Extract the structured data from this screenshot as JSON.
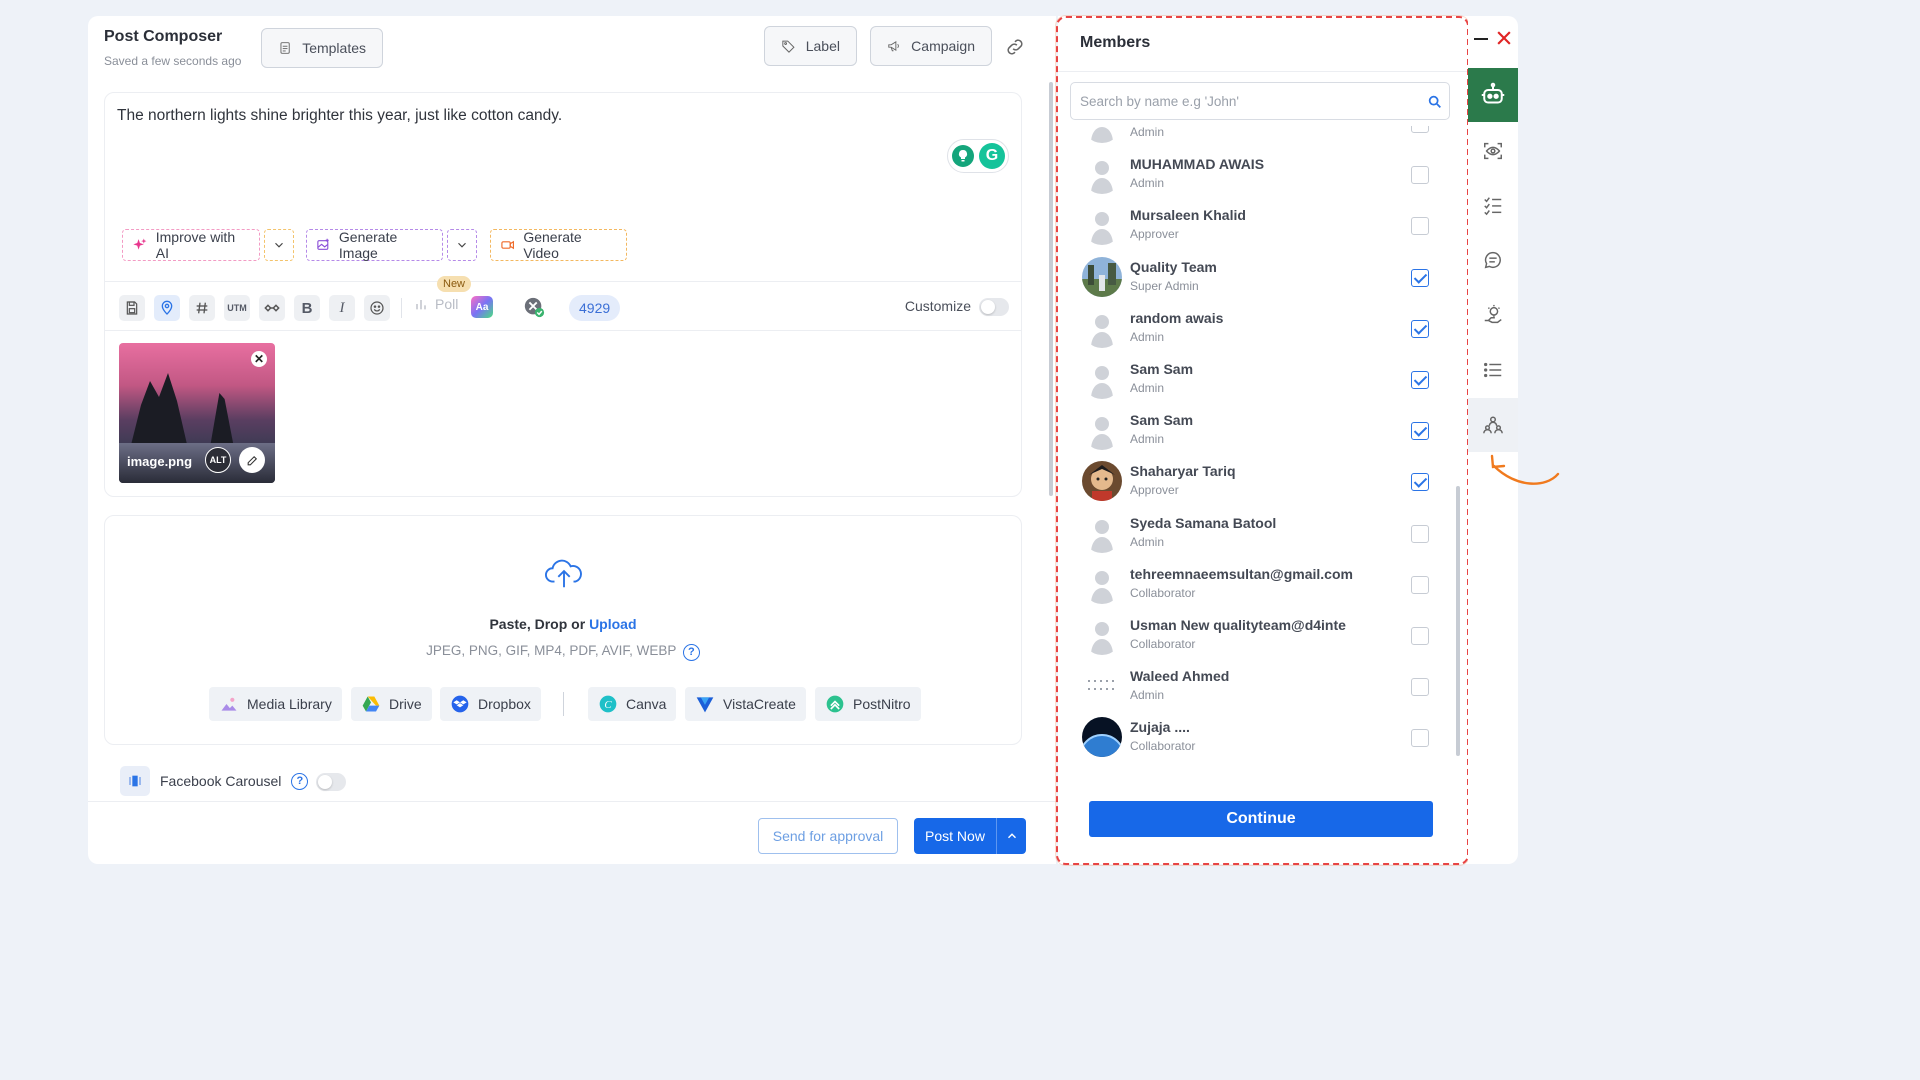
{
  "header": {
    "title": "Post Composer",
    "subtitle": "Saved a few seconds ago",
    "templates_label": "Templates",
    "label_label": "Label",
    "campaign_label": "Campaign"
  },
  "editor": {
    "text": "The northern lights shine brighter this year, just like cotton candy.",
    "improve_label": "Improve with AI",
    "generate_image_label": "Generate Image",
    "generate_video_label": "Generate Video",
    "poll_label": "Poll",
    "new_badge": "New",
    "utm_label": "UTM",
    "bold_label": "B",
    "italic_label": "I",
    "aa_label": "Aa",
    "char_count": "4929",
    "customize_label": "Customize",
    "customize_on": false
  },
  "media": {
    "filename": "image.png",
    "alt_label": "ALT"
  },
  "upload": {
    "prompt_prefix": "Paste, Drop or",
    "upload_link": "Upload",
    "formats": "JPEG, PNG, GIF, MP4, PDF, AVIF, WEBP",
    "sources": [
      "Media Library",
      "Drive",
      "Dropbox",
      "Canva",
      "VistaCreate",
      "PostNitro"
    ]
  },
  "carousel": {
    "label": "Facebook Carousel",
    "enabled": false
  },
  "footer": {
    "approval_label": "Send for approval",
    "post_now_label": "Post Now"
  },
  "members": {
    "title": "Members",
    "search_placeholder": "Search by name e.g 'John'",
    "continue_label": "Continue",
    "items": [
      {
        "name": "",
        "role": "Admin",
        "checked": false,
        "avatar": "default"
      },
      {
        "name": "MUHAMMAD AWAIS",
        "role": "Admin",
        "checked": false,
        "avatar": "default"
      },
      {
        "name": "Mursaleen Khalid",
        "role": "Approver",
        "checked": false,
        "avatar": "default"
      },
      {
        "name": "Quality Team",
        "role": "Super Admin",
        "checked": true,
        "avatar": "photo-outdoor"
      },
      {
        "name": "random awais",
        "role": "Admin",
        "checked": true,
        "avatar": "default"
      },
      {
        "name": "Sam Sam",
        "role": "Admin",
        "checked": true,
        "avatar": "default"
      },
      {
        "name": "Sam Sam",
        "role": "Admin",
        "checked": true,
        "avatar": "default"
      },
      {
        "name": "Shaharyar Tariq",
        "role": "Approver",
        "checked": true,
        "avatar": "photo-portrait"
      },
      {
        "name": "Syeda Samana Batool",
        "role": "Admin",
        "checked": false,
        "avatar": "default"
      },
      {
        "name": "tehreemnaeemsultan@gmail.com",
        "role": "Collaborator",
        "checked": false,
        "avatar": "default"
      },
      {
        "name": "Usman New qualityteam@d4inte",
        "role": "Collaborator",
        "checked": false,
        "avatar": "default"
      },
      {
        "name": "Waleed Ahmed",
        "role": "Admin",
        "checked": false,
        "avatar": "pattern"
      },
      {
        "name": "Zujaja ....",
        "role": "Collaborator",
        "checked": false,
        "avatar": "photo-earth"
      }
    ]
  },
  "rail": {
    "icons": [
      "robot-icon",
      "eye-scan-icon",
      "checklist-icon",
      "comment-icon",
      "idea-hand-icon",
      "list-icon",
      "members-icon"
    ],
    "active": "members-icon"
  },
  "colors": {
    "primary": "#1768e8",
    "annotation": "#e84444",
    "rail_active_bg": "#2b7a4b"
  }
}
